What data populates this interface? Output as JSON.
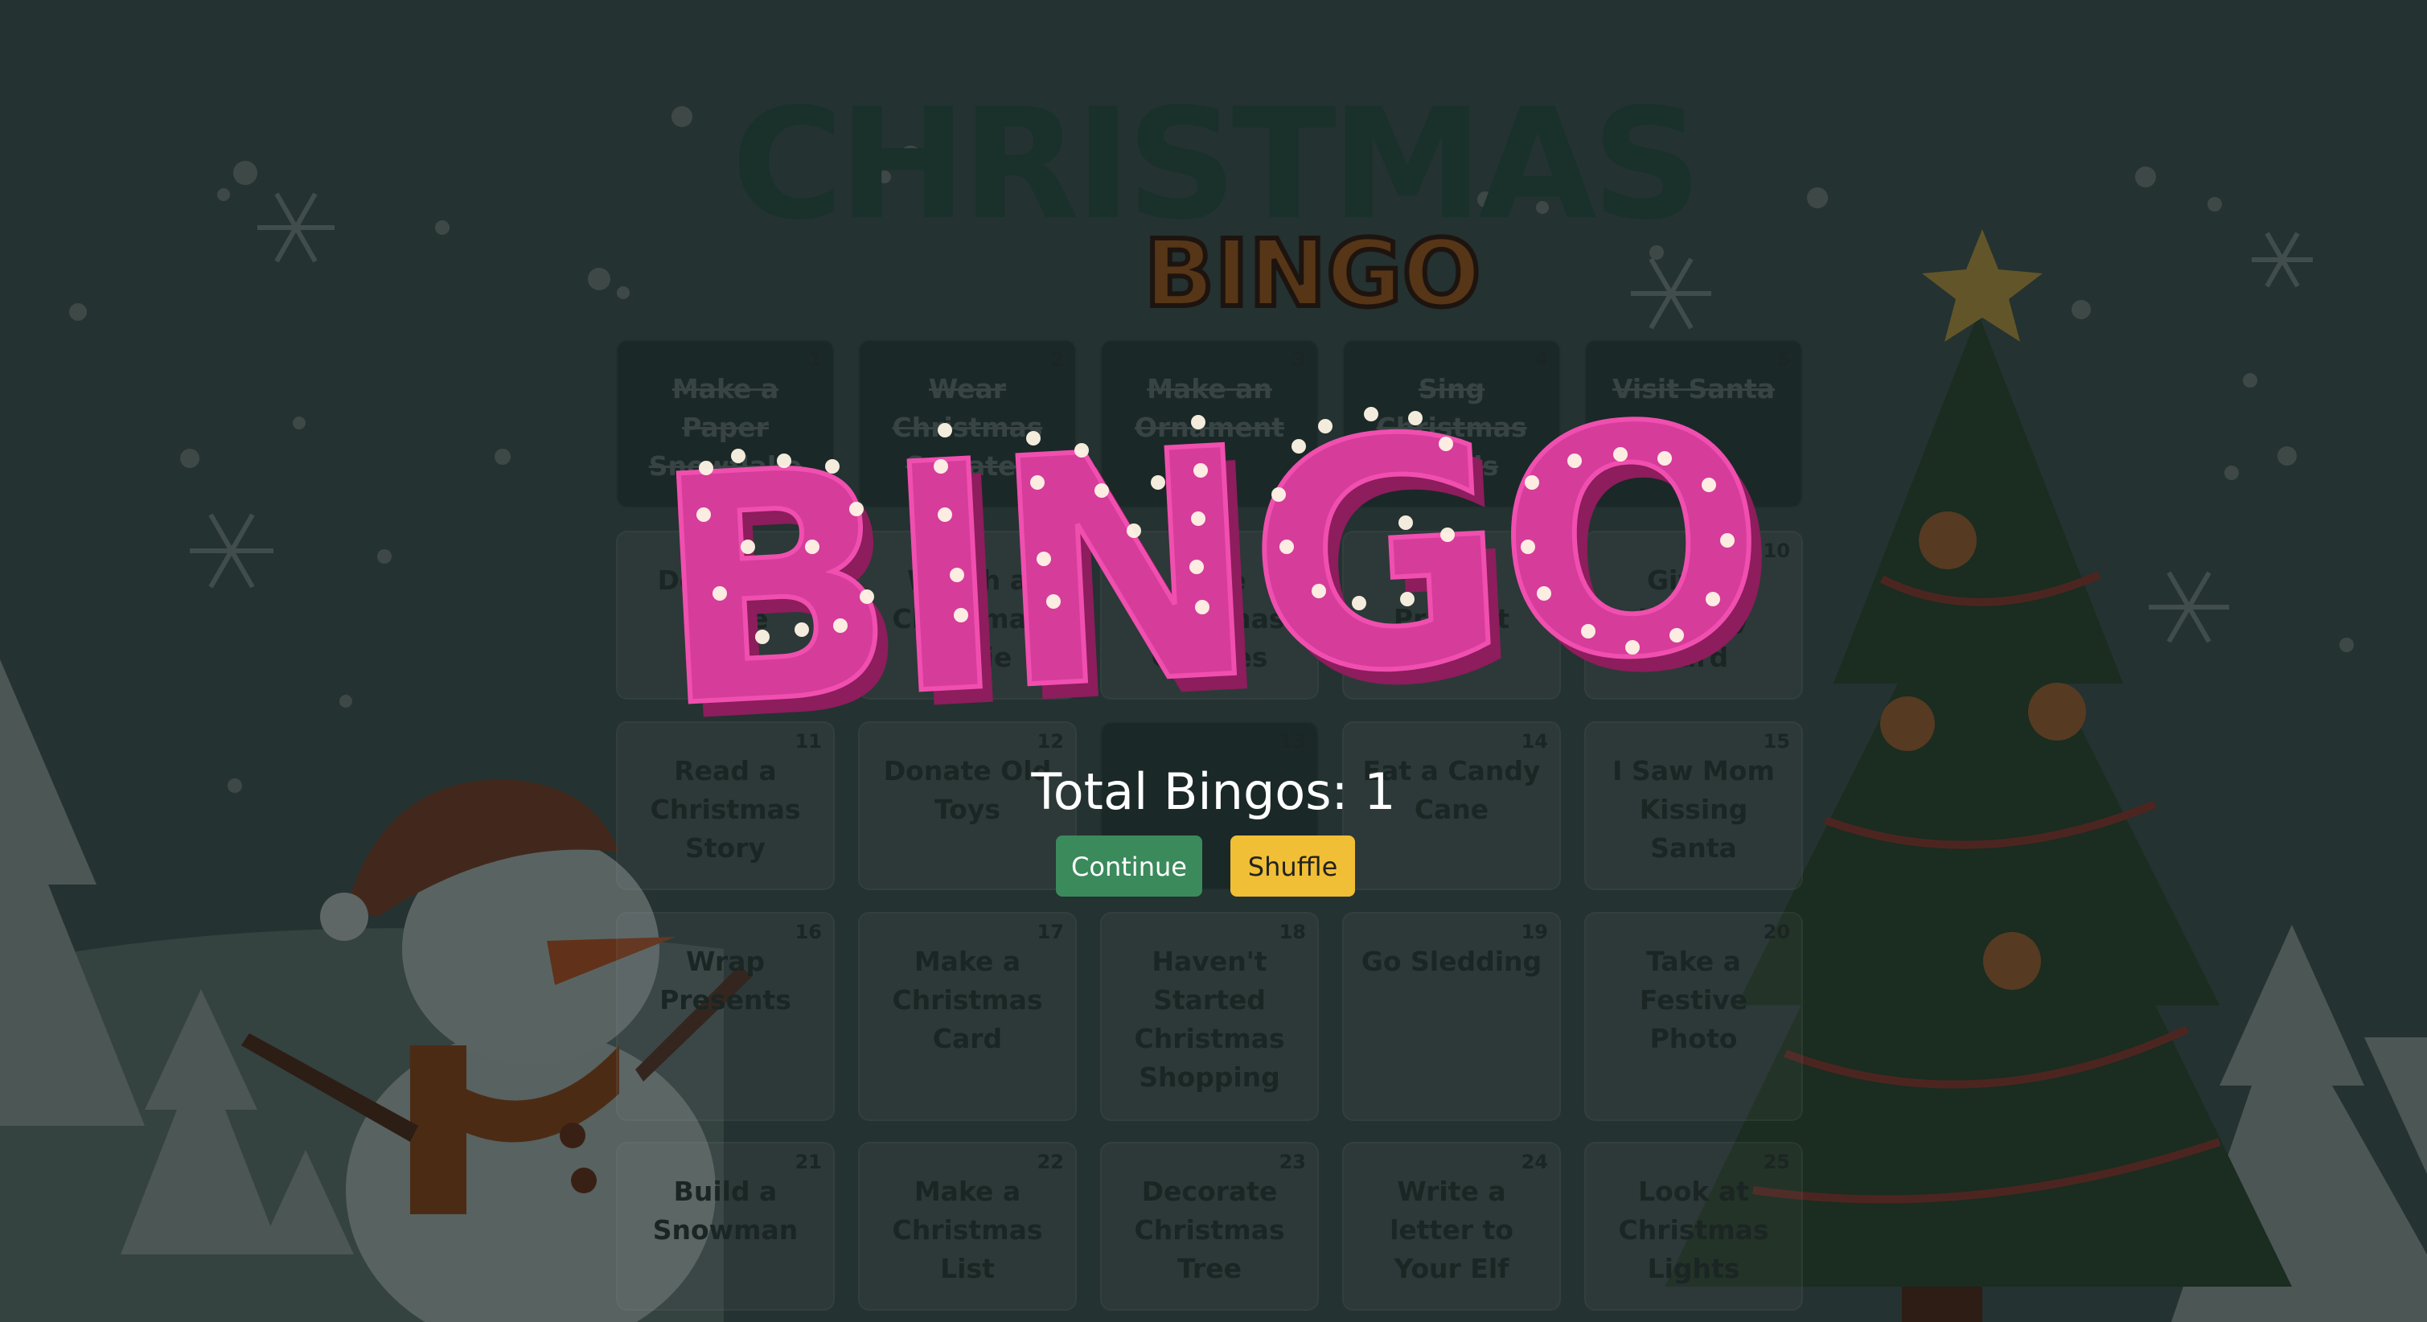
{
  "title": {
    "line1": "CHRISTMAS",
    "line2": "BINGO"
  },
  "cells": [
    {
      "n": "1",
      "text": "Make a Paper Snowflake",
      "marked": true
    },
    {
      "n": "2",
      "text": "Wear Christmas Sweater",
      "marked": true
    },
    {
      "n": "3",
      "text": "Make an Ornament",
      "marked": true
    },
    {
      "n": "4",
      "text": "Sing Christmas Carols",
      "marked": true
    },
    {
      "n": "5",
      "text": "Visit Santa",
      "marked": true
    },
    {
      "n": "6",
      "text": "Decorate Home",
      "marked": false
    },
    {
      "n": "7",
      "text": "Watch a Christmas Movie",
      "marked": false
    },
    {
      "n": "8",
      "text": "Bake Christmas Cookies",
      "marked": false
    },
    {
      "n": "9",
      "text": "Buy a Present",
      "marked": false
    },
    {
      "n": "10",
      "text": "Give a Holiday Card",
      "marked": false
    },
    {
      "n": "11",
      "text": "Read a Christmas Story",
      "marked": false
    },
    {
      "n": "12",
      "text": "Donate Old Toys",
      "marked": false
    },
    {
      "n": "13",
      "text": "",
      "marked": true
    },
    {
      "n": "14",
      "text": "Eat a Candy Cane",
      "marked": false
    },
    {
      "n": "15",
      "text": "I Saw Mom Kissing Santa",
      "marked": false
    },
    {
      "n": "16",
      "text": "Wrap Presents",
      "marked": false
    },
    {
      "n": "17",
      "text": "Make a Christmas Card",
      "marked": false
    },
    {
      "n": "18",
      "text": "Haven't Started Christmas Shopping",
      "marked": false
    },
    {
      "n": "19",
      "text": "Go Sledding",
      "marked": false
    },
    {
      "n": "20",
      "text": "Take a Festive Photo",
      "marked": false
    },
    {
      "n": "21",
      "text": "Build a Snowman",
      "marked": false
    },
    {
      "n": "22",
      "text": "Make a Christmas List",
      "marked": false
    },
    {
      "n": "23",
      "text": "Decorate Christmas Tree",
      "marked": false
    },
    {
      "n": "24",
      "text": "Write a letter to Your Elf",
      "marked": false
    },
    {
      "n": "25",
      "text": "Look at Christmas Lights",
      "marked": false
    }
  ],
  "popup": {
    "banner": "BINGO",
    "total_label": "Total Bingos: 1",
    "continue_label": "Continue",
    "shuffle_label": "Shuffle"
  },
  "colors": {
    "banner": "#d63c9a",
    "continue": "#3b8a5c",
    "shuffle": "#f0bf35",
    "bg": "#2d3e3c"
  }
}
